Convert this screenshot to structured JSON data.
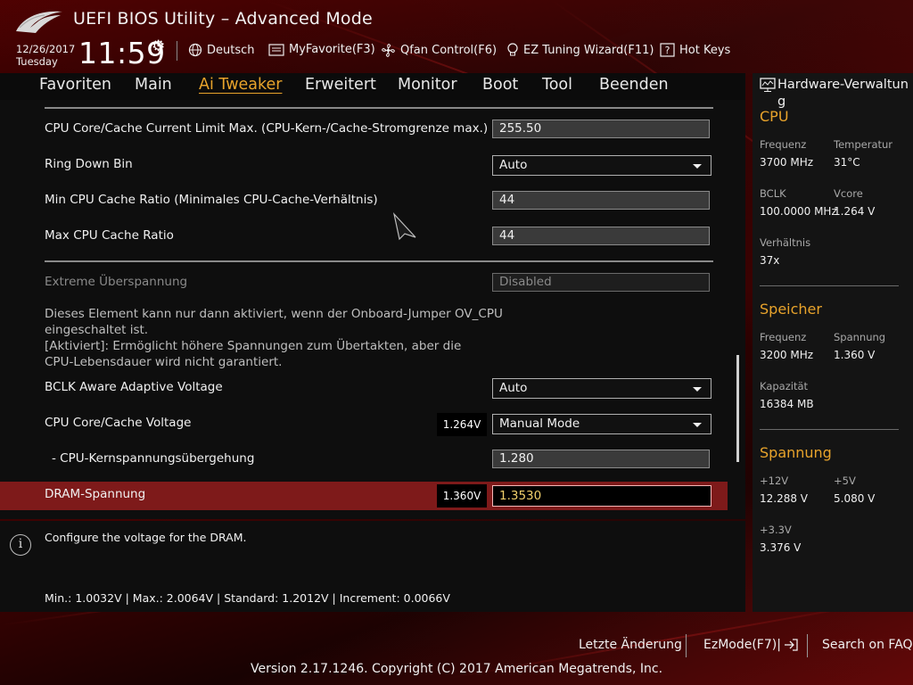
{
  "header": {
    "title": "UEFI BIOS Utility – Advanced Mode",
    "date": "12/26/2017",
    "weekday": "Tuesday",
    "time": "11:59",
    "language": "Deutsch",
    "myfavorite": "MyFavorite(F3)",
    "qfan": "Qfan Control(F6)",
    "ez_tuning": "EZ Tuning Wizard(F11)",
    "hot_keys": "Hot Keys"
  },
  "menu": {
    "items": [
      "Favoriten",
      "Main",
      "Ai Tweaker",
      "Erweitert",
      "Monitor",
      "Boot",
      "Tool",
      "Beenden"
    ],
    "active": "Ai Tweaker"
  },
  "settings": {
    "current_limit": {
      "label": "CPU Core/Cache Current Limit Max. (CPU-Kern-/Cache-Stromgrenze max.)",
      "value": "255.50"
    },
    "ring_down_bin": {
      "label": "Ring Down Bin",
      "value": "Auto"
    },
    "min_cache_ratio": {
      "label": "Min CPU Cache Ratio (Minimales CPU-Cache-Verhältnis)",
      "value": "44"
    },
    "max_cache_ratio": {
      "label": "Max CPU Cache Ratio",
      "value": "44"
    },
    "extreme_overvoltage": {
      "label": "Extreme Überspannung",
      "value": "Disabled"
    },
    "description_lines": [
      "Dieses Element kann nur dann aktiviert, wenn der Onboard-Jumper OV_CPU",
      "eingeschaltet ist.",
      "[Aktiviert]: Ermöglicht höhere Spannungen zum Übertakten, aber die",
      "CPU-Lebensdauer wird nicht garantiert."
    ],
    "bclk_adaptive": {
      "label": "BCLK Aware Adaptive Voltage",
      "value": "Auto"
    },
    "core_cache_voltage": {
      "label": "CPU Core/Cache Voltage",
      "current": "1.264V",
      "value": "Manual Mode"
    },
    "core_override": {
      "label": "- CPU-Kernspannungsübergehung",
      "value": "1.280"
    },
    "dram_voltage": {
      "label": "DRAM-Spannung",
      "current": "1.360V",
      "value": "1.3530"
    }
  },
  "help": {
    "text": "Configure the voltage for the DRAM.",
    "footer": "Min.: 1.0032V  |   Max.: 2.0064V  |   Standard: 1.2012V  |   Increment: 0.0066V"
  },
  "hardware": {
    "title": "Hardware-Verwaltung",
    "cpu": {
      "heading": "CPU",
      "freq_label": "Frequenz",
      "freq": "3700 MHz",
      "temp_label": "Temperatur",
      "temp": "31°C",
      "bclk_label": "BCLK",
      "bclk": "100.0000 MHz",
      "vcore_label": "Vcore",
      "vcore": "1.264 V",
      "ratio_label": "Verhältnis",
      "ratio": "37x"
    },
    "memory": {
      "heading": "Speicher",
      "freq_label": "Frequenz",
      "freq": "3200 MHz",
      "volt_label": "Spannung",
      "volt": "1.360 V",
      "cap_label": "Kapazität",
      "cap": "16384 MB"
    },
    "voltage": {
      "heading": "Spannung",
      "v12_label": "+12V",
      "v12": "12.288 V",
      "v5_label": "+5V",
      "v5": "5.080 V",
      "v33_label": "+3.3V",
      "v33": "3.376 V"
    }
  },
  "footer": {
    "last_change": "Letzte Änderung",
    "ezmode": "EzMode(F7)|",
    "faq": "Search on FAQ",
    "version": "Version 2.17.1246. Copyright (C) 2017 American Megatrends, Inc."
  },
  "colors": {
    "accent": "#e8a32b",
    "highlight_row": "#7e1a1a",
    "active_value": "#f2d06b"
  }
}
